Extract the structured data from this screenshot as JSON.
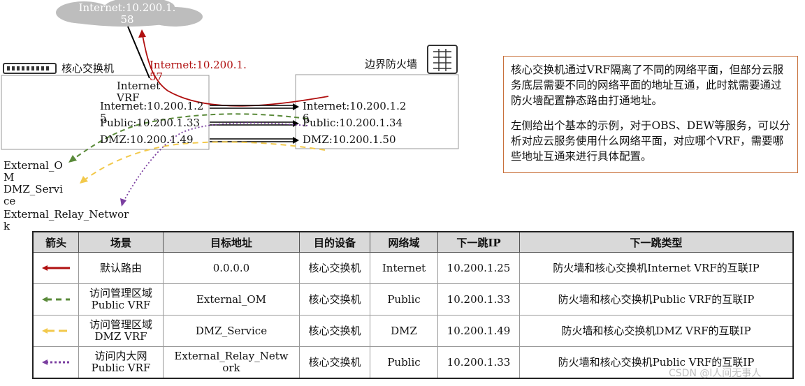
{
  "cloud": {
    "label_line1": "Internet:10.200.1.",
    "label_line2": "58"
  },
  "core_switch": {
    "label": "核心交换机",
    "vrf_line1": "Internet",
    "vrf_line2": "VRF",
    "internet_line1": "Internet:10.200.1.2",
    "internet_line2": "5",
    "public": "Public:10.200.1.33",
    "dmz": "DMZ:10.200.1.49"
  },
  "uplink_label": {
    "line1": "Internet:10.200.1.",
    "line2": "57"
  },
  "firewall": {
    "label": "边界防火墙",
    "internet_line1": "Internet:10.200.1.2",
    "internet_line2": "6",
    "public": "Public:10.200.1.34",
    "dmz": "DMZ:10.200.1.50"
  },
  "destinations": {
    "external_om_1": "External_O",
    "external_om_2": "M",
    "dmz_service_1": "DMZ_Servi",
    "dmz_service_2": "ce",
    "relay_1": "External_Relay_Networ",
    "relay_2": "k"
  },
  "note": {
    "para1": "核心交换机通过VRF隔离了不同的网络平面，但部分云服务底层需要不同的网络平面的地址互通，此时就需要通过防火墙配置静态路由打通地址。",
    "para2": "左侧给出个基本的示例，对于OBS、DEW等服务，可以分析对应云服务使用什么网络平面，对应哪个VRF，需要哪些地址互通来进行具体配置。"
  },
  "table": {
    "headers": [
      "箭头",
      "场景",
      "目标地址",
      "目的设备",
      "网络域",
      "下一跳IP",
      "下一跳类型"
    ],
    "rows": [
      {
        "arrow": "red-solid",
        "scenario_1": "默认路由",
        "scenario_2": "",
        "target": "0.0.0.0",
        "device": "核心交换机",
        "domain": "Internet",
        "next_hop": "10.200.1.25",
        "next_hop_type": "防火墙和核心交换机Internet VRF的互联IP"
      },
      {
        "arrow": "green-dashed",
        "scenario_1": "访问管理区域",
        "scenario_2": "Public VRF",
        "target": "External_OM",
        "device": "核心交换机",
        "domain": "Public",
        "next_hop": "10.200.1.33",
        "next_hop_type": "防火墙和核心交换机Public VRF的互联IP"
      },
      {
        "arrow": "yellow-dashed",
        "scenario_1": "访问管理区域",
        "scenario_2": "DMZ VRF",
        "target": "DMZ_Service",
        "device": "核心交换机",
        "domain": "DMZ",
        "next_hop": "10.200.1.49",
        "next_hop_type": "防火墙和核心交换机DMZ VRF的互联IP"
      },
      {
        "arrow": "purple-dotted",
        "scenario_1": "访问内大网",
        "scenario_2": "Public VRF",
        "target": "External_Relay_Netw",
        "target_2": "ork",
        "device": "核心交换机",
        "domain": "Public",
        "next_hop": "10.200.1.33",
        "next_hop_type": "防火墙和核心交换机Public VRF的互联IP"
      }
    ]
  },
  "watermark": "CSDN @l人间无事人",
  "colors": {
    "red": "#b01010",
    "green": "#5a8a3a",
    "yellow": "#f2c94c",
    "purple": "#7b3fa0",
    "note_border": "#c8703a"
  }
}
